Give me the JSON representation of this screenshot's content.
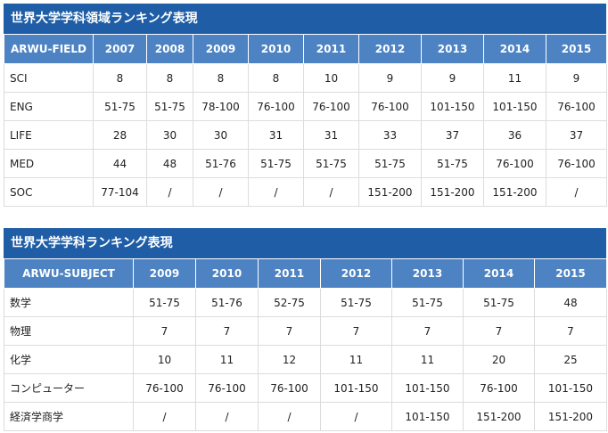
{
  "table1": {
    "title": "世界大学学科領域ランキング表現",
    "headers": [
      "ARWU-FIELD",
      "2007",
      "2008",
      "2009",
      "2010",
      "2011",
      "2012",
      "2013",
      "2014",
      "2015"
    ],
    "rows": [
      [
        "SCI",
        "8",
        "8",
        "8",
        "8",
        "10",
        "9",
        "9",
        "11",
        "9"
      ],
      [
        "ENG",
        "51-75",
        "51-75",
        "78-100",
        "76-100",
        "76-100",
        "76-100",
        "101-150",
        "101-150",
        "76-100"
      ],
      [
        "LIFE",
        "28",
        "30",
        "30",
        "31",
        "31",
        "33",
        "37",
        "36",
        "37"
      ],
      [
        "MED",
        "44",
        "48",
        "51-76",
        "51-75",
        "51-75",
        "51-75",
        "51-75",
        "76-100",
        "76-100"
      ],
      [
        "SOC",
        "77-104",
        "/",
        "/",
        "/",
        "/",
        "151-200",
        "151-200",
        "151-200",
        "/"
      ]
    ]
  },
  "table2": {
    "title": "世界大学学科ランキング表現",
    "headers": [
      "ARWU-SUBJECT",
      "2009",
      "2010",
      "2011",
      "2012",
      "2013",
      "2014",
      "2015"
    ],
    "rows": [
      [
        "数学",
        "51-75",
        "51-76",
        "52-75",
        "51-75",
        "51-75",
        "51-75",
        "48"
      ],
      [
        "物理",
        "7",
        "7",
        "7",
        "7",
        "7",
        "7",
        "7"
      ],
      [
        "化学",
        "10",
        "11",
        "12",
        "11",
        "11",
        "20",
        "25"
      ],
      [
        "コンピューター",
        "76-100",
        "76-100",
        "76-100",
        "101-150",
        "101-150",
        "76-100",
        "101-150"
      ],
      [
        "経済学商学",
        "/",
        "/",
        "/",
        "/",
        "101-150",
        "151-200",
        "151-200"
      ]
    ]
  }
}
